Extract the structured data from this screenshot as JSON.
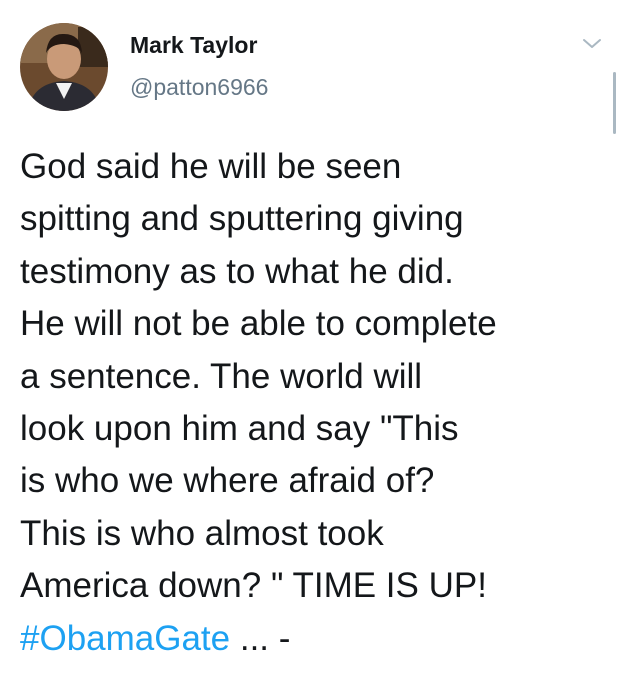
{
  "author": {
    "display_name": "Mark Taylor",
    "handle": "@patton6966"
  },
  "menu": {
    "icon": "chevron-down-icon"
  },
  "tweet": {
    "lines": [
      "God said he will be seen",
      "spitting and sputtering giving",
      "testimony as to what he did.",
      "He will not be able to complete",
      "a sentence. The world will",
      "look upon him and say \"This",
      "is who we where afraid of?",
      "This is who almost took",
      "America down? \" TIME IS UP!"
    ],
    "hashtag": "#ObamaGate",
    "trailing": " ... -"
  },
  "colors": {
    "text": "#14171a",
    "secondary": "#657786",
    "link": "#1da1f2"
  }
}
